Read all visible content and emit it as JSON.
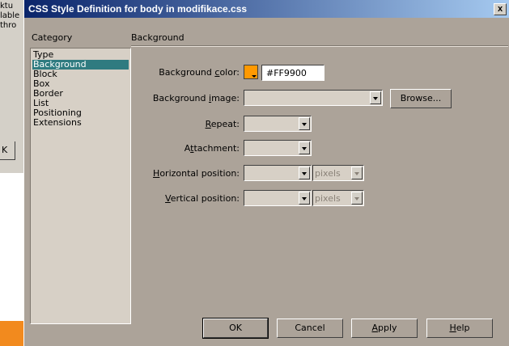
{
  "background_window": {
    "text_lines": [
      "ktu",
      "lable",
      "thro"
    ],
    "button_label": "K"
  },
  "dialog": {
    "title": "CSS Style Definition for body in modifikace.css",
    "close_label": "x",
    "category_header": "Category",
    "section_header": "Background",
    "categories": [
      "Type",
      "Background",
      "Block",
      "Box",
      "Border",
      "List",
      "Positioning",
      "Extensions"
    ],
    "selected_category": "Background",
    "fields": {
      "bg_color": {
        "label_pre": "Background ",
        "label_u": "c",
        "label_post": "olor:",
        "value": "#FF9900",
        "swatch": "#ff9900"
      },
      "bg_image": {
        "label_pre": "Background ",
        "label_u": "i",
        "label_post": "mage:",
        "value": "",
        "browse_label": "Browse..."
      },
      "repeat": {
        "label_pre": "",
        "label_u": "R",
        "label_post": "epeat:",
        "value": ""
      },
      "attachment": {
        "label_pre": "A",
        "label_u": "t",
        "label_post": "tachment:",
        "value": ""
      },
      "horizontal_position": {
        "label_pre": "",
        "label_u": "H",
        "label_post": "orizontal position:",
        "value": "",
        "unit": "pixels"
      },
      "vertical_position": {
        "label_pre": "",
        "label_u": "V",
        "label_post": "ertical position:",
        "value": "",
        "unit": "pixels"
      }
    },
    "buttons": {
      "ok": "OK",
      "cancel": "Cancel",
      "apply_u": "A",
      "apply_rest": "pply",
      "help_u": "H",
      "help_rest": "elp"
    }
  }
}
